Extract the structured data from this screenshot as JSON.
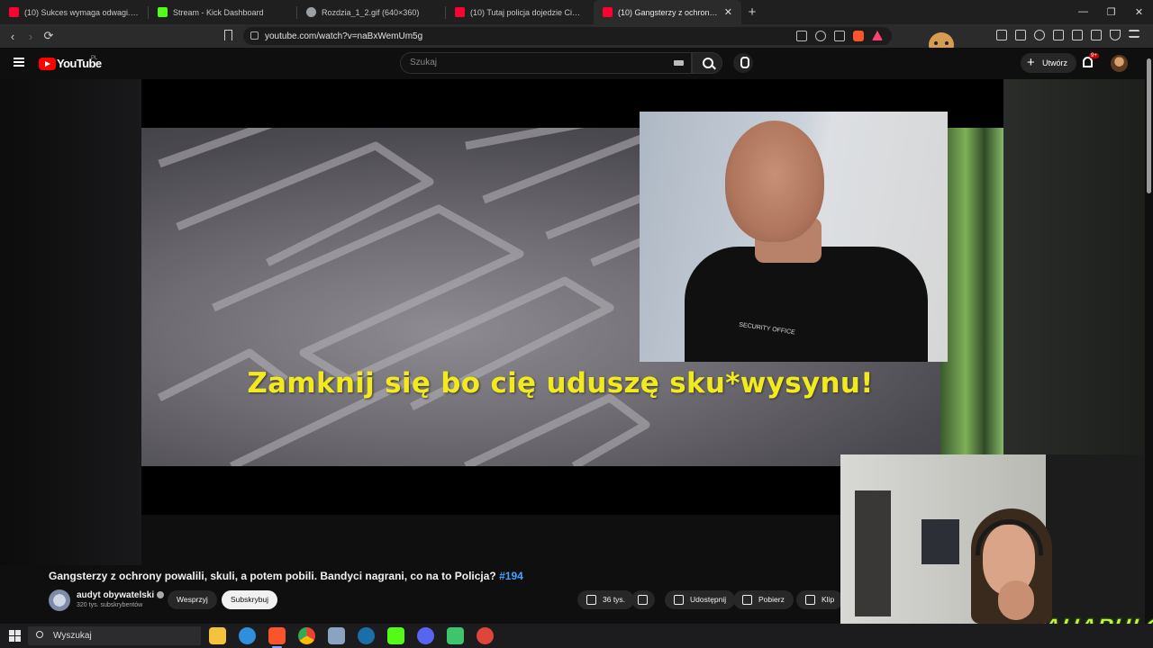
{
  "browser": {
    "tabs": [
      {
        "title": "(10) Sukces wymaga odwagi. I trochę",
        "favicon_color": "#ff0033",
        "active": false
      },
      {
        "title": "Stream - Kick Dashboard",
        "favicon_color": "#53fc18",
        "active": false
      },
      {
        "title": "Rozdzia_1_2.gif (640×360)",
        "favicon_color": "#9aa0a6",
        "active": false
      },
      {
        "title": "(10) Tutaj policja dojedzie Ciebie i to",
        "favicon_color": "#ff0033",
        "active": false
      },
      {
        "title": "(10) Gangsterzy z ochrony po",
        "favicon_color": "#ff0033",
        "active": true
      }
    ],
    "new_tab": "+",
    "url": "youtube.com/watch?v=naBxWemUm5g",
    "window_controls": [
      "—",
      "❐",
      "✕"
    ],
    "nav": {
      "back": "‹",
      "forward": "›",
      "reload": "⟳"
    }
  },
  "youtube": {
    "logo_text": "YouTube",
    "country_code": "PL",
    "search_placeholder": "Szukaj",
    "create_label": "Utwórz",
    "notification_count": "9+"
  },
  "video": {
    "subtitle": "Zamknij się bo cię uduszę sku*wysynu!",
    "shirt_logo": "SECURITY OFFICE",
    "title": "Gangsterzy z ochrony powalili, skuli, a potem pobili. Bandyci nagrani, co na to Policja?",
    "hashtag": "#194",
    "channel_name": "audyt obywatelski",
    "subscribers": "320 tys. subskrybentów",
    "support_label": "Wesprzyj",
    "subscribe_label": "Subskrybuj",
    "likes": "36 tys.",
    "share_label": "Udostępnij",
    "download_label": "Pobierz",
    "clip_label": "Klip"
  },
  "overlay": {
    "brand_text": "AHAPULCO"
  },
  "taskbar": {
    "search_label": "Wyszukaj",
    "apps": [
      {
        "name": "file-explorer",
        "color": "#f3c33b"
      },
      {
        "name": "edge",
        "color": "#2f8fdc"
      },
      {
        "name": "brave",
        "color": "#fb542b"
      },
      {
        "name": "chrome",
        "color": "#34a853"
      },
      {
        "name": "notepad",
        "color": "#8aa3c0"
      },
      {
        "name": "steam",
        "color": "#1b6fa8"
      },
      {
        "name": "kick",
        "color": "#53fc18"
      },
      {
        "name": "discord",
        "color": "#5865f2"
      },
      {
        "name": "app-green",
        "color": "#3cc56b"
      },
      {
        "name": "app-red",
        "color": "#e0453a"
      }
    ]
  }
}
